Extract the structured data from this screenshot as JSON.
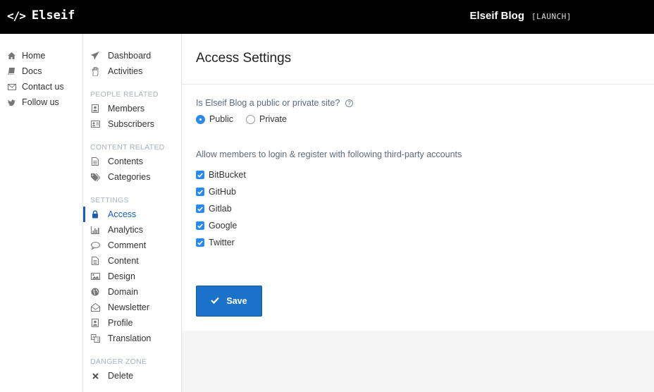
{
  "header": {
    "brand_icon": "</>",
    "brand_name": "Elseif",
    "site_title": "Elseif Blog",
    "launch_label": "[LAUNCH]"
  },
  "left_nav": [
    {
      "label": "Home",
      "icon": "home-icon"
    },
    {
      "label": "Docs",
      "icon": "book-icon"
    },
    {
      "label": "Contact us",
      "icon": "envelope-icon"
    },
    {
      "label": "Follow us",
      "icon": "twitter-icon"
    }
  ],
  "mid_nav": {
    "top": [
      {
        "label": "Dashboard",
        "icon": "paper-plane-icon"
      },
      {
        "label": "Activities",
        "icon": "hand-icon"
      }
    ],
    "people_heading": "PEOPLE RELATED",
    "people": [
      {
        "label": "Members",
        "icon": "user-badge-icon"
      },
      {
        "label": "Subscribers",
        "icon": "id-card-icon"
      }
    ],
    "content_heading": "CONTENT RELATED",
    "content": [
      {
        "label": "Contents",
        "icon": "file-icon"
      },
      {
        "label": "Categories",
        "icon": "tags-icon"
      }
    ],
    "settings_heading": "SETTINGS",
    "settings": [
      {
        "label": "Access",
        "icon": "lock-icon",
        "active": true
      },
      {
        "label": "Analytics",
        "icon": "bar-chart-icon"
      },
      {
        "label": "Comment",
        "icon": "comment-icon"
      },
      {
        "label": "Content",
        "icon": "file-text-icon"
      },
      {
        "label": "Design",
        "icon": "image-icon"
      },
      {
        "label": "Domain",
        "icon": "globe-icon"
      },
      {
        "label": "Newsletter",
        "icon": "envelope-open-icon"
      },
      {
        "label": "Profile",
        "icon": "profile-icon"
      },
      {
        "label": "Translation",
        "icon": "language-icon"
      }
    ],
    "danger_heading": "DANGER ZONE",
    "danger": [
      {
        "label": "Delete",
        "icon": "close-icon"
      }
    ]
  },
  "main": {
    "title": "Access Settings",
    "visibility_question": "Is Elseif Blog a public or private site?",
    "help_symbol": "?",
    "visibility_options": [
      {
        "label": "Public",
        "selected": true
      },
      {
        "label": "Private",
        "selected": false
      }
    ],
    "providers_question": "Allow members to login & register with following third-party accounts",
    "providers": [
      {
        "label": "BitBucket",
        "checked": true
      },
      {
        "label": "GitHub",
        "checked": true
      },
      {
        "label": "Gitlab",
        "checked": true
      },
      {
        "label": "Google",
        "checked": true
      },
      {
        "label": "Twitter",
        "checked": true
      }
    ],
    "save_label": "Save"
  },
  "colors": {
    "topbar": "#000000",
    "accent": "#2b8be8",
    "active_nav": "#1a5fb4",
    "save_button": "#1a73c8",
    "section_heading": "#aab2bd"
  }
}
